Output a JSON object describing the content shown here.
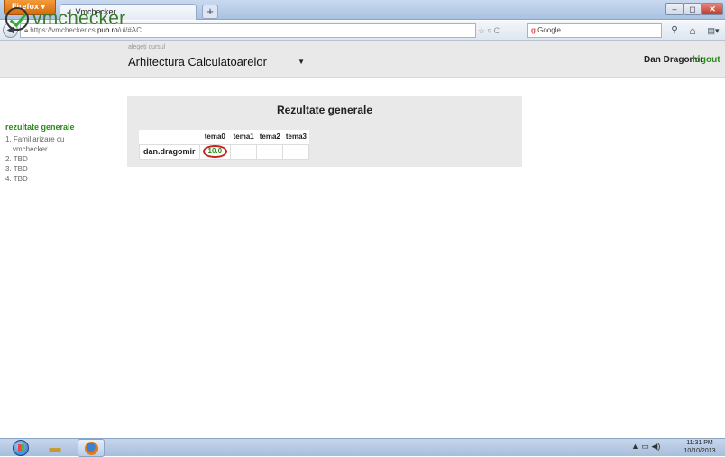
{
  "browser": {
    "menu_button": "Firefox ▾",
    "tab_title": "Vmchecker",
    "tab_icon": "✓",
    "new_tab": "+",
    "url_prefix": "https://vmchecker.cs.",
    "url_domain": "pub.ro",
    "url_suffix": "/ui/#AC",
    "url_icons": "☆ ▿ C",
    "search_engine": "Google",
    "window_controls": {
      "minimize": "–",
      "maximize": "◻",
      "close": "✕"
    }
  },
  "header": {
    "logo_text": "vmchecker",
    "course_label": "alegeți cursul",
    "course_selected": "Arhitectura Calculatoarelor",
    "username": "Dan Dragomir",
    "logout": "logout"
  },
  "sidebar": {
    "title": "rezultate generale",
    "items": [
      {
        "label": "1. Familiarizare cu"
      },
      {
        "label": "vmchecker"
      },
      {
        "label": "2. TBD"
      },
      {
        "label": "3. TBD"
      },
      {
        "label": "4. TBD"
      }
    ]
  },
  "results": {
    "title": "Rezultate generale",
    "columns": [
      "",
      "tema0",
      "tema1",
      "tema2",
      "tema3"
    ],
    "rows": [
      {
        "name": "dan.dragomir",
        "scores": [
          "10.0",
          "",
          "",
          ""
        ]
      }
    ]
  },
  "taskbar": {
    "clock_time": "11:31 PM",
    "clock_date": "10/10/2013"
  },
  "colors": {
    "accent_green": "#2a8a1a",
    "logo_green": "#3a7a2e",
    "highlight_red": "#cc2222"
  }
}
